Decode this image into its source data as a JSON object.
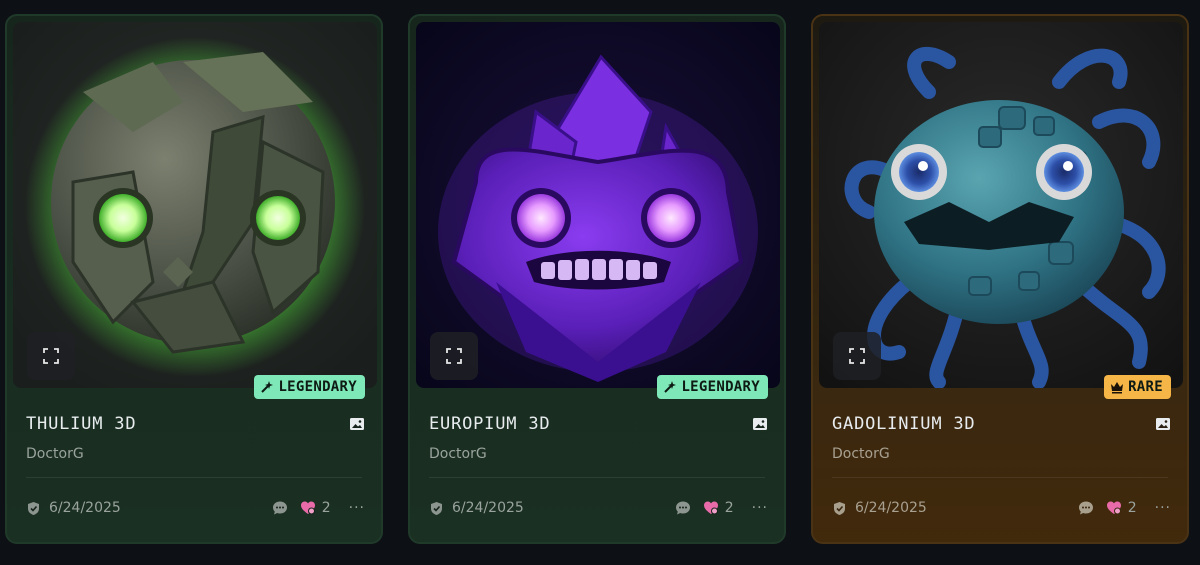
{
  "cards": [
    {
      "title": "THULIUM 3D",
      "creator": "DoctorG",
      "rarity": "LEGENDARY",
      "date": "6/24/2025",
      "likes": "2",
      "more": "···",
      "theme": "green"
    },
    {
      "title": "EUROPIUM 3D",
      "creator": "DoctorG",
      "rarity": "LEGENDARY",
      "date": "6/24/2025",
      "likes": "2",
      "more": "···",
      "theme": "green"
    },
    {
      "title": "GADOLINIUM 3D",
      "creator": "DoctorG",
      "rarity": "RARE",
      "date": "6/24/2025",
      "likes": "2",
      "more": "···",
      "theme": "amber"
    }
  ],
  "colors": {
    "legendary": "#7ee8b8",
    "rare": "#f5b547",
    "like": "#e86aa8"
  },
  "icons": {
    "expand": "expand-icon",
    "legendary": "sparkle-wand-icon",
    "rare": "crown-icon",
    "media": "image-icon",
    "verified": "shield-check-icon",
    "comment": "chat-bubble-icon",
    "like": "heart-icon"
  }
}
